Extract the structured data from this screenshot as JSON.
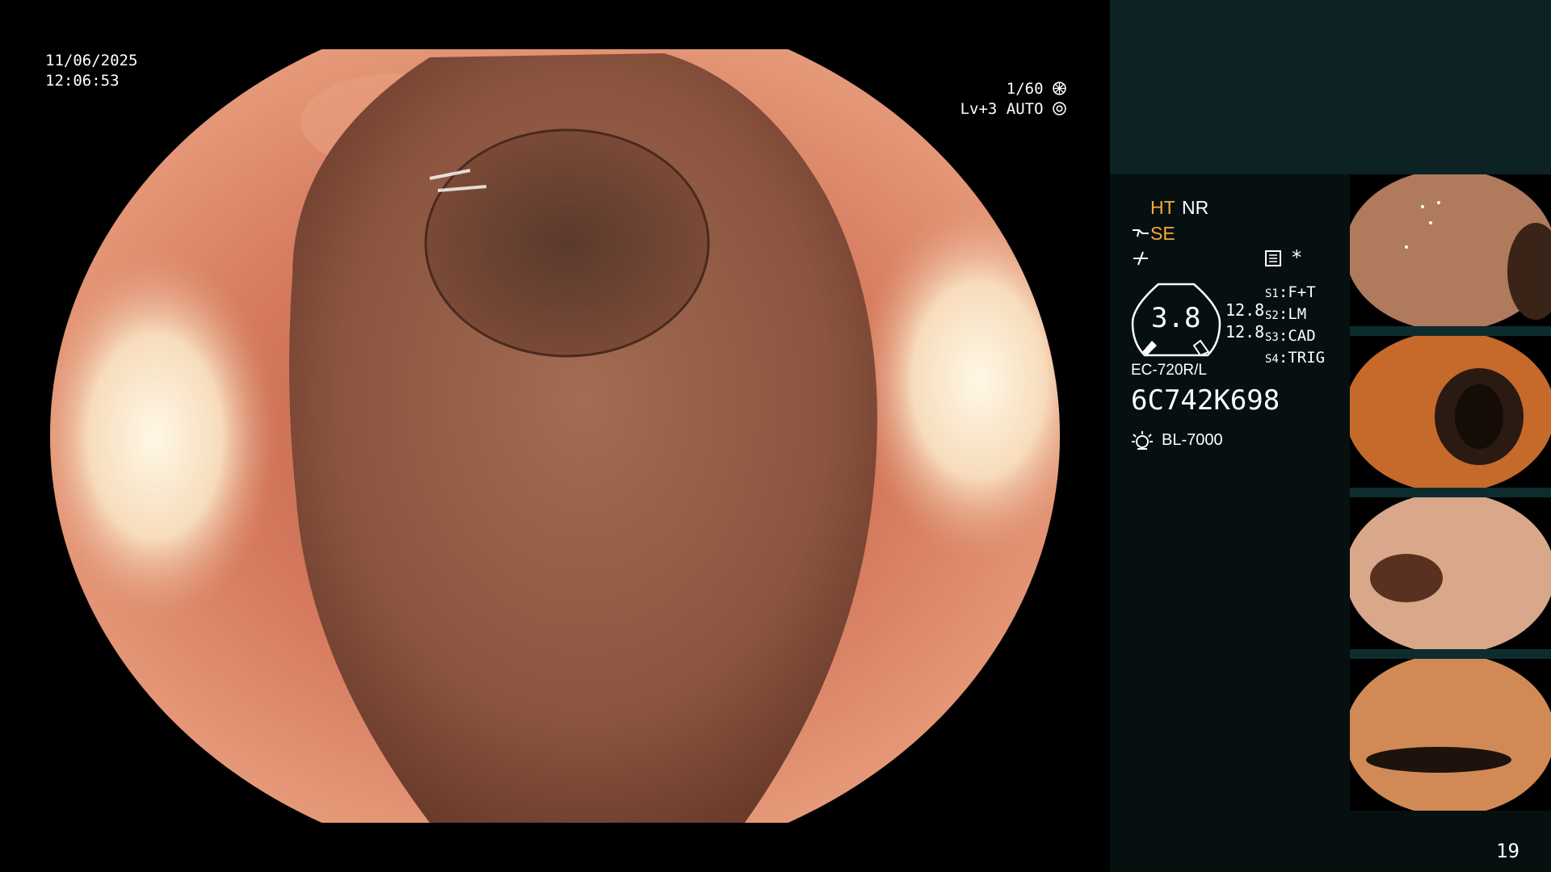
{
  "osd": {
    "date": "11/06/2025",
    "time": "12:06:53",
    "shutter": "1/60",
    "iris": "Lv+3 AUTO"
  },
  "panel": {
    "ht": "HT",
    "nr": "NR",
    "se": "SE",
    "gauge_value": "3.8",
    "val_a": "12.8",
    "val_b": "12.8",
    "switches": [
      {
        "key": "S1",
        "value": "F+T"
      },
      {
        "key": "S2",
        "value": "LM"
      },
      {
        "key": "S3",
        "value": "CAD"
      },
      {
        "key": "S4",
        "value": "TRIG"
      }
    ],
    "scope_model": "EC-720R/L",
    "serial": "6C742K698",
    "light_source": "BL-7000",
    "image_count": "19"
  },
  "icons": {
    "shutter": "shutter-icon",
    "iris": "iris-icon",
    "light": "light-source-icon"
  },
  "colors": {
    "accent": "#f5a83c",
    "panel_bg": "#071010",
    "panel_top": "#0c2225"
  }
}
